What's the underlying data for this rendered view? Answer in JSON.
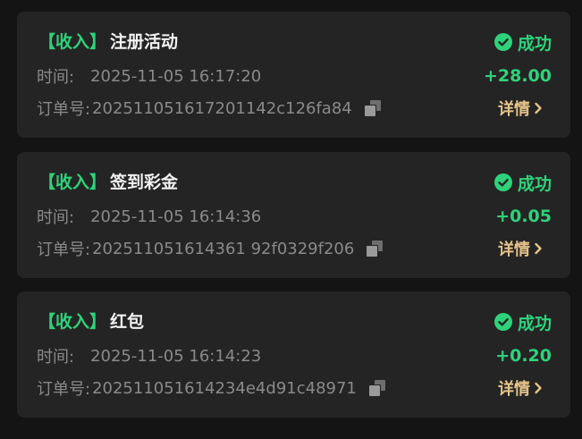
{
  "records": [
    {
      "tag": "【收入】",
      "title": "注册活动",
      "status": "成功",
      "time_label": "时间:",
      "time": "2025-11-05 16:17:20",
      "amount": "+28.00",
      "order_label": "订单号:",
      "order_no": "202511051617201142c126fa84",
      "detail_label": "详情"
    },
    {
      "tag": "【收入】",
      "title": "签到彩金",
      "status": "成功",
      "time_label": "时间:",
      "time": "2025-11-05 16:14:36",
      "amount": "+0.05",
      "order_label": "订单号:",
      "order_no": "202511051614361 92f0329f206",
      "detail_label": "详情"
    },
    {
      "tag": "【收入】",
      "title": "红包",
      "status": "成功",
      "time_label": "时间:",
      "time": "2025-11-05 16:14:23",
      "amount": "+0.20",
      "order_label": "订单号:",
      "order_no": "202511051614234e4d91c48971",
      "detail_label": "详情"
    }
  ],
  "colors": {
    "background": "#141414",
    "card": "#242424",
    "success": "#2fd27a",
    "muted": "#8a8a8a",
    "detail": "#e6c48a",
    "title": "#f2f2f2"
  },
  "icons": {
    "status": "check-circle-icon",
    "copy": "copy-icon",
    "detail": "chevron-right-icon"
  }
}
